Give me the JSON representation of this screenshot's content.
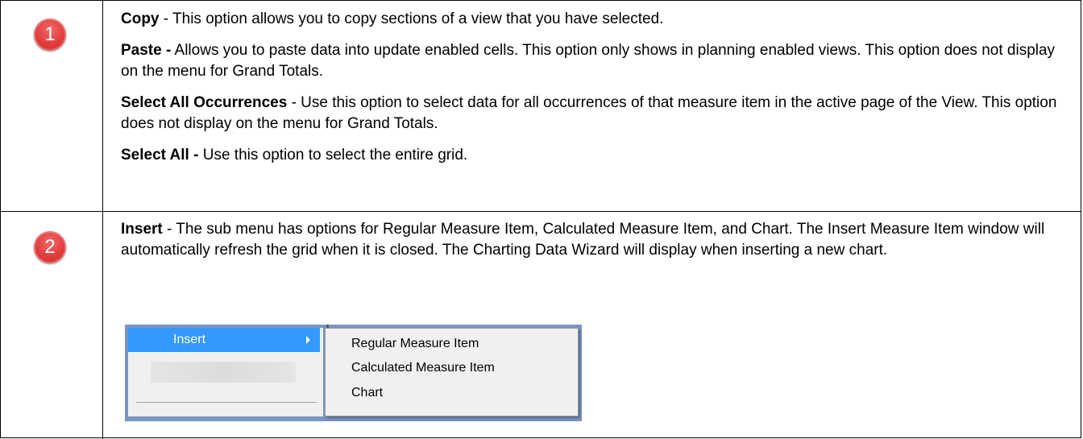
{
  "rows": [
    {
      "number": "1",
      "paragraphs": [
        {
          "term": "Copy",
          "text": " - This option allows you to copy sections of a view that you have selected."
        },
        {
          "term": "Paste -",
          "text": " Allows you to paste data into update enabled cells. This option only shows in planning enabled views. This option does not display on the menu for Grand Totals."
        },
        {
          "term": "Select All Occurrences",
          "text": " - Use this option to select data for all occurrences of that measure item in the active page of the View. This option does not display on the menu for Grand Totals."
        },
        {
          "term": "Select All -",
          "text": " Use this option to select the entire grid."
        }
      ]
    },
    {
      "number": "2",
      "paragraphs": [
        {
          "term": "Insert",
          "text": " - The sub menu has options for Regular Measure Item, Calculated Measure Item, and Chart. The Insert Measure Item window will automatically refresh the grid when it is closed. The Charting Data Wizard will display when inserting a new chart."
        }
      ],
      "menu": {
        "item": "Insert",
        "submenu": [
          "Regular Measure Item",
          "Calculated Measure Item",
          "Chart"
        ]
      }
    }
  ],
  "colors": {
    "badge": "#e23c3c",
    "menu_highlight": "#3399ff",
    "menu_background": "#f0f0f0"
  }
}
